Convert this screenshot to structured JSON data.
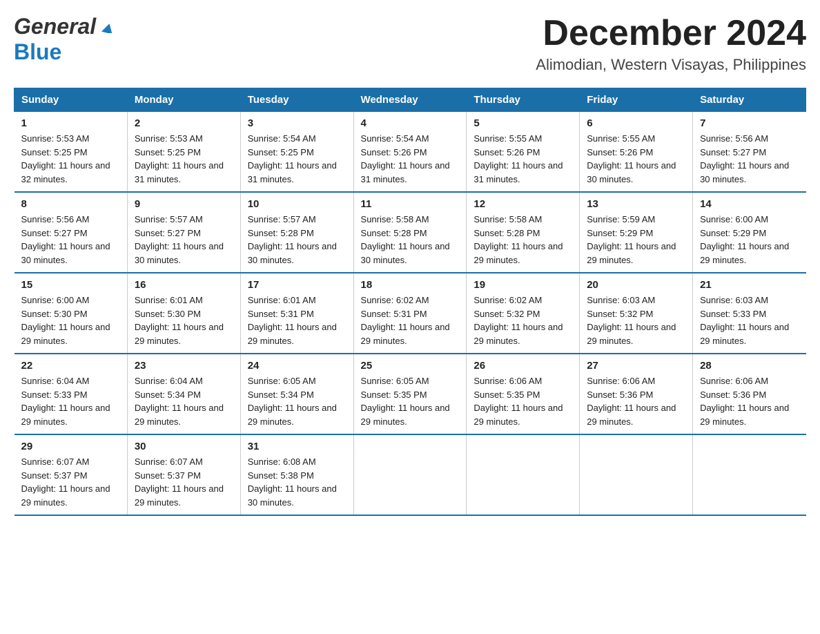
{
  "logo": {
    "line1": "General",
    "line2": "Blue"
  },
  "header": {
    "month": "December 2024",
    "location": "Alimodian, Western Visayas, Philippines"
  },
  "days_of_week": [
    "Sunday",
    "Monday",
    "Tuesday",
    "Wednesday",
    "Thursday",
    "Friday",
    "Saturday"
  ],
  "weeks": [
    [
      {
        "day": "1",
        "sunrise": "5:53 AM",
        "sunset": "5:25 PM",
        "daylight": "11 hours and 32 minutes."
      },
      {
        "day": "2",
        "sunrise": "5:53 AM",
        "sunset": "5:25 PM",
        "daylight": "11 hours and 31 minutes."
      },
      {
        "day": "3",
        "sunrise": "5:54 AM",
        "sunset": "5:25 PM",
        "daylight": "11 hours and 31 minutes."
      },
      {
        "day": "4",
        "sunrise": "5:54 AM",
        "sunset": "5:26 PM",
        "daylight": "11 hours and 31 minutes."
      },
      {
        "day": "5",
        "sunrise": "5:55 AM",
        "sunset": "5:26 PM",
        "daylight": "11 hours and 31 minutes."
      },
      {
        "day": "6",
        "sunrise": "5:55 AM",
        "sunset": "5:26 PM",
        "daylight": "11 hours and 30 minutes."
      },
      {
        "day": "7",
        "sunrise": "5:56 AM",
        "sunset": "5:27 PM",
        "daylight": "11 hours and 30 minutes."
      }
    ],
    [
      {
        "day": "8",
        "sunrise": "5:56 AM",
        "sunset": "5:27 PM",
        "daylight": "11 hours and 30 minutes."
      },
      {
        "day": "9",
        "sunrise": "5:57 AM",
        "sunset": "5:27 PM",
        "daylight": "11 hours and 30 minutes."
      },
      {
        "day": "10",
        "sunrise": "5:57 AM",
        "sunset": "5:28 PM",
        "daylight": "11 hours and 30 minutes."
      },
      {
        "day": "11",
        "sunrise": "5:58 AM",
        "sunset": "5:28 PM",
        "daylight": "11 hours and 30 minutes."
      },
      {
        "day": "12",
        "sunrise": "5:58 AM",
        "sunset": "5:28 PM",
        "daylight": "11 hours and 29 minutes."
      },
      {
        "day": "13",
        "sunrise": "5:59 AM",
        "sunset": "5:29 PM",
        "daylight": "11 hours and 29 minutes."
      },
      {
        "day": "14",
        "sunrise": "6:00 AM",
        "sunset": "5:29 PM",
        "daylight": "11 hours and 29 minutes."
      }
    ],
    [
      {
        "day": "15",
        "sunrise": "6:00 AM",
        "sunset": "5:30 PM",
        "daylight": "11 hours and 29 minutes."
      },
      {
        "day": "16",
        "sunrise": "6:01 AM",
        "sunset": "5:30 PM",
        "daylight": "11 hours and 29 minutes."
      },
      {
        "day": "17",
        "sunrise": "6:01 AM",
        "sunset": "5:31 PM",
        "daylight": "11 hours and 29 minutes."
      },
      {
        "day": "18",
        "sunrise": "6:02 AM",
        "sunset": "5:31 PM",
        "daylight": "11 hours and 29 minutes."
      },
      {
        "day": "19",
        "sunrise": "6:02 AM",
        "sunset": "5:32 PM",
        "daylight": "11 hours and 29 minutes."
      },
      {
        "day": "20",
        "sunrise": "6:03 AM",
        "sunset": "5:32 PM",
        "daylight": "11 hours and 29 minutes."
      },
      {
        "day": "21",
        "sunrise": "6:03 AM",
        "sunset": "5:33 PM",
        "daylight": "11 hours and 29 minutes."
      }
    ],
    [
      {
        "day": "22",
        "sunrise": "6:04 AM",
        "sunset": "5:33 PM",
        "daylight": "11 hours and 29 minutes."
      },
      {
        "day": "23",
        "sunrise": "6:04 AM",
        "sunset": "5:34 PM",
        "daylight": "11 hours and 29 minutes."
      },
      {
        "day": "24",
        "sunrise": "6:05 AM",
        "sunset": "5:34 PM",
        "daylight": "11 hours and 29 minutes."
      },
      {
        "day": "25",
        "sunrise": "6:05 AM",
        "sunset": "5:35 PM",
        "daylight": "11 hours and 29 minutes."
      },
      {
        "day": "26",
        "sunrise": "6:06 AM",
        "sunset": "5:35 PM",
        "daylight": "11 hours and 29 minutes."
      },
      {
        "day": "27",
        "sunrise": "6:06 AM",
        "sunset": "5:36 PM",
        "daylight": "11 hours and 29 minutes."
      },
      {
        "day": "28",
        "sunrise": "6:06 AM",
        "sunset": "5:36 PM",
        "daylight": "11 hours and 29 minutes."
      }
    ],
    [
      {
        "day": "29",
        "sunrise": "6:07 AM",
        "sunset": "5:37 PM",
        "daylight": "11 hours and 29 minutes."
      },
      {
        "day": "30",
        "sunrise": "6:07 AM",
        "sunset": "5:37 PM",
        "daylight": "11 hours and 29 minutes."
      },
      {
        "day": "31",
        "sunrise": "6:08 AM",
        "sunset": "5:38 PM",
        "daylight": "11 hours and 30 minutes."
      },
      null,
      null,
      null,
      null
    ]
  ],
  "labels": {
    "sunrise": "Sunrise:",
    "sunset": "Sunset:",
    "daylight": "Daylight:"
  }
}
